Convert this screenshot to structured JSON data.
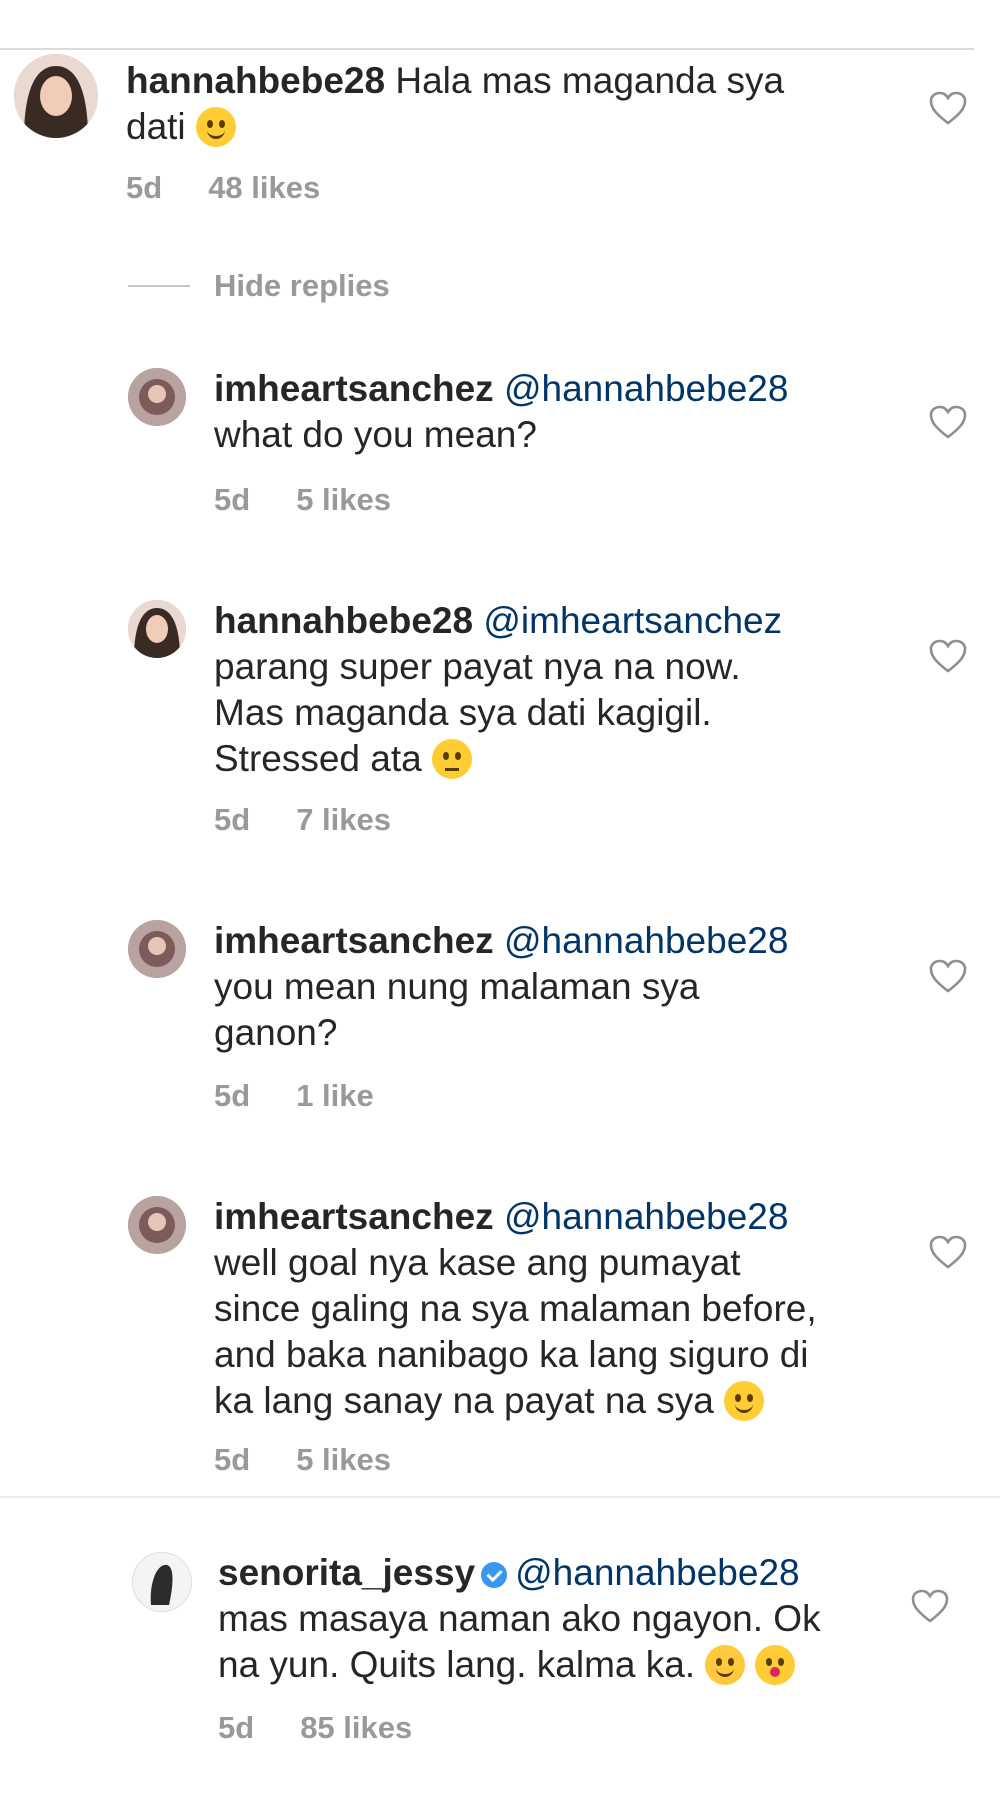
{
  "comments": [
    {
      "username": "hannahbebe28",
      "mention": "",
      "lines": [
        "Hala mas maganda sya",
        "dati"
      ],
      "time": "5d",
      "likes": "48 likes",
      "emoji": "smiley-icon"
    },
    {
      "username": "imheartsanchez",
      "mention": "@hannahbebe28",
      "lines": [
        "what do you mean?"
      ],
      "time": "5d",
      "likes": "5 likes"
    },
    {
      "username": "hannahbebe28",
      "mention": "@imheartsanchez",
      "lines": [
        "parang super payat nya na now.",
        "Mas maganda sya dati kagigil.",
        "Stressed ata"
      ],
      "time": "5d",
      "likes": "7 likes",
      "emoji": "thinking-face-icon"
    },
    {
      "username": "imheartsanchez",
      "mention": "@hannahbebe28",
      "lines": [
        "you mean nung malaman sya",
        "ganon?"
      ],
      "time": "5d",
      "likes": "1 like"
    },
    {
      "username": "imheartsanchez",
      "mention": "@hannahbebe28",
      "lines": [
        "well goal nya kase ang pumayat",
        "since galing na sya malaman before,",
        "and baka nanibago ka lang siguro di",
        "ka lang sanay na payat na sya"
      ],
      "time": "5d",
      "likes": "5 likes",
      "emoji": "smiley-icon"
    },
    {
      "username": "senorita_jessy",
      "mention": "@hannahbebe28",
      "lines": [
        "mas masaya naman ako ngayon. Ok",
        "na yun. Quits lang. kalma ka."
      ],
      "time": "5d",
      "likes": "85 likes",
      "verified": true,
      "emoji": "hugging-face-icon, kissing-face-icon"
    }
  ],
  "hide_replies_label": "Hide replies",
  "colors": {
    "text": "#262626",
    "mention": "#003569",
    "meta": "#999999",
    "verified": "#3897f0"
  }
}
